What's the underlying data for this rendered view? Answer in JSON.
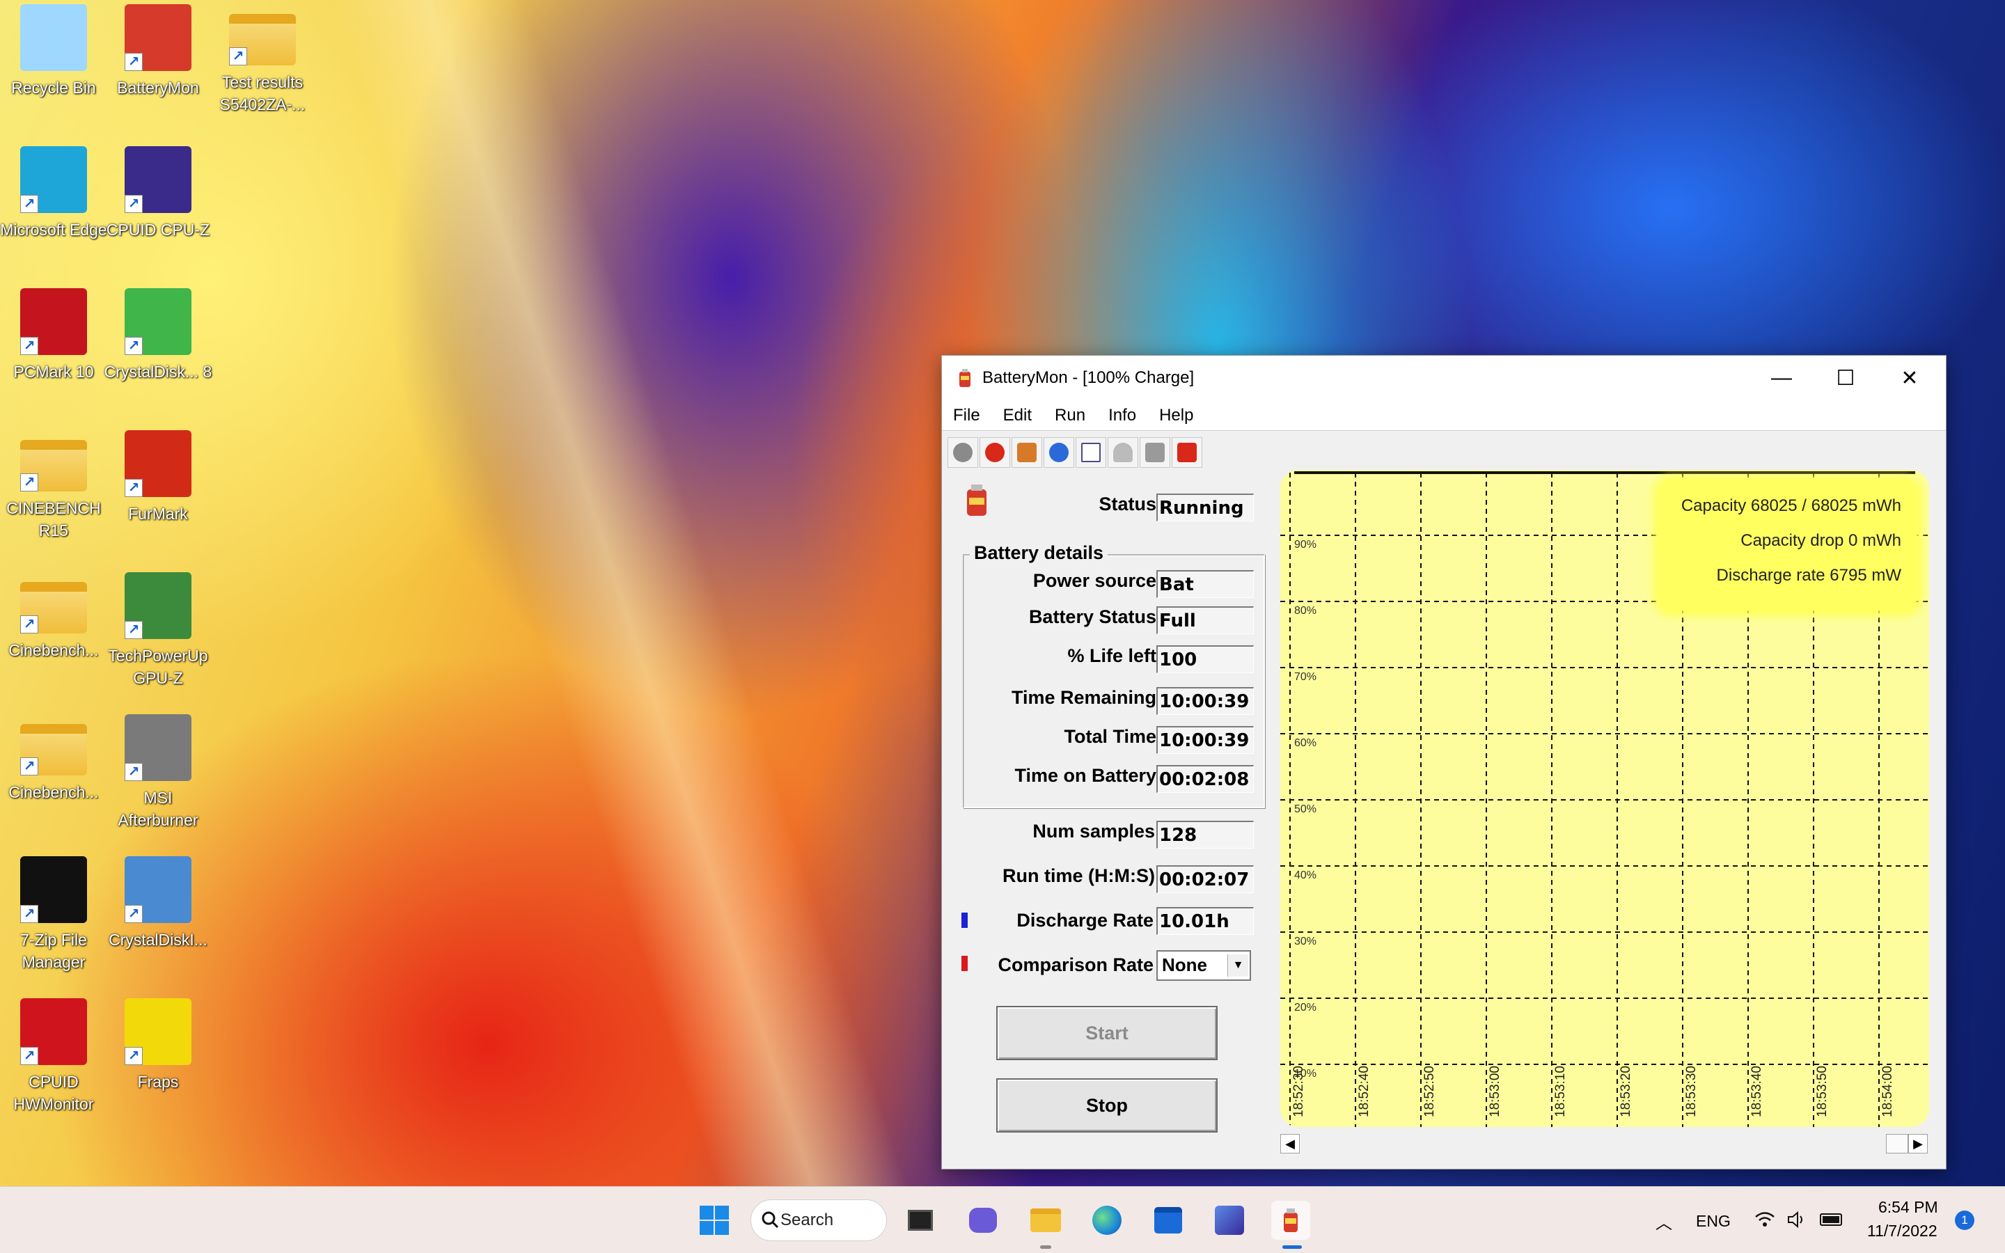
{
  "desktop_icons": [
    {
      "label": "Recycle Bin",
      "icon": "recycle-bin-icon",
      "color": "#9ed7ff"
    },
    {
      "label": "BatteryMon",
      "icon": "batterymon-icon",
      "color": "#d63a2a"
    },
    {
      "label": "Test results S5402ZA-...",
      "icon": "folder-icon",
      "color": "#f7cf5a"
    },
    {
      "label": "Microsoft Edge",
      "icon": "edge-icon",
      "color": "#1fa6d8"
    },
    {
      "label": "CPUID CPU-Z",
      "icon": "cpuz-icon",
      "color": "#3a2a8a"
    },
    {
      "label": "PCMark 10",
      "icon": "pcmark-icon",
      "color": "#c4141e"
    },
    {
      "label": "CrystalDisk... 8",
      "icon": "crystaldiskmark-icon",
      "color": "#3fb54a"
    },
    {
      "label": "CINEBENCH R15",
      "icon": "folder-icon",
      "color": "#f7cf5a"
    },
    {
      "label": "FurMark",
      "icon": "furmark-icon",
      "color": "#d12a16"
    },
    {
      "label": "Cinebench...",
      "icon": "folder-icon",
      "color": "#f7cf5a"
    },
    {
      "label": "TechPowerUp GPU-Z",
      "icon": "gpuz-icon",
      "color": "#3c8a3c"
    },
    {
      "label": "Cinebench...",
      "icon": "folder-icon",
      "color": "#f7cf5a"
    },
    {
      "label": "MSI Afterburner",
      "icon": "afterburner-icon",
      "color": "#7a7a7a"
    },
    {
      "label": "7-Zip File Manager",
      "icon": "7zip-icon",
      "color": "#111111"
    },
    {
      "label": "CrystalDiskI...",
      "icon": "crystaldiskinfo-icon",
      "color": "#4a8ad0"
    },
    {
      "label": "CPUID HWMonitor",
      "icon": "hwmonitor-icon",
      "color": "#d0141e"
    },
    {
      "label": "Fraps",
      "icon": "fraps-icon",
      "color": "#f2d90a"
    }
  ],
  "window": {
    "title": "BatteryMon - [100% Charge]",
    "minimize_glyph": "—",
    "maximize_glyph": "☐",
    "close_glyph": "✕",
    "menu": [
      "File",
      "Edit",
      "Run",
      "Info",
      "Help"
    ],
    "toolbar_icons": [
      "record-icon",
      "stop-icon",
      "battery-icon",
      "info-icon",
      "checklist-icon",
      "gauge-icon",
      "hand-icon",
      "tools-icon"
    ]
  },
  "panel": {
    "status_label": "Status",
    "status_value": "Running",
    "group_title": "Battery details",
    "details": [
      {
        "label": "Power source",
        "value": "Bat"
      },
      {
        "label": "Battery Status",
        "value": "Full"
      },
      {
        "label": "% Life left",
        "value": "100"
      },
      {
        "label": "Time Remaining",
        "value": "10:00:39"
      },
      {
        "label": "Total Time",
        "value": "10:00:39"
      },
      {
        "label": "Time on Battery",
        "value": "00:02:08"
      }
    ],
    "num_samples_label": "Num samples",
    "num_samples_value": "128",
    "run_time_label": "Run time (H:M:S)",
    "run_time_value": "00:02:07",
    "discharge_label": "Discharge Rate",
    "discharge_value": "10.01h",
    "discharge_color": "#1a22d8",
    "comparison_label": "Comparison Rate",
    "comparison_value": "None",
    "comparison_color": "#d81a1a",
    "start_label": "Start",
    "stop_label": "Stop"
  },
  "graph": {
    "info": [
      "Capacity 68025 / 68025 mWh",
      "Capacity drop 0 mWh",
      "Discharge rate 6795 mW"
    ],
    "percent_labels": [
      "90%",
      "80%",
      "70%",
      "60%",
      "50%",
      "40%",
      "30%",
      "20%",
      "10%"
    ],
    "time_labels": [
      "18:52:30",
      "18:52:40",
      "18:52:50",
      "18:53:00",
      "18:53:10",
      "18:53:20",
      "18:53:30",
      "18:53:40",
      "18:53:50",
      "18:54:00"
    ],
    "background": "#fdfd9e"
  },
  "taskbar": {
    "search_label": "Search",
    "lang": "ENG",
    "time": "6:54 PM",
    "date": "11/7/2022",
    "notification_count": "1"
  }
}
